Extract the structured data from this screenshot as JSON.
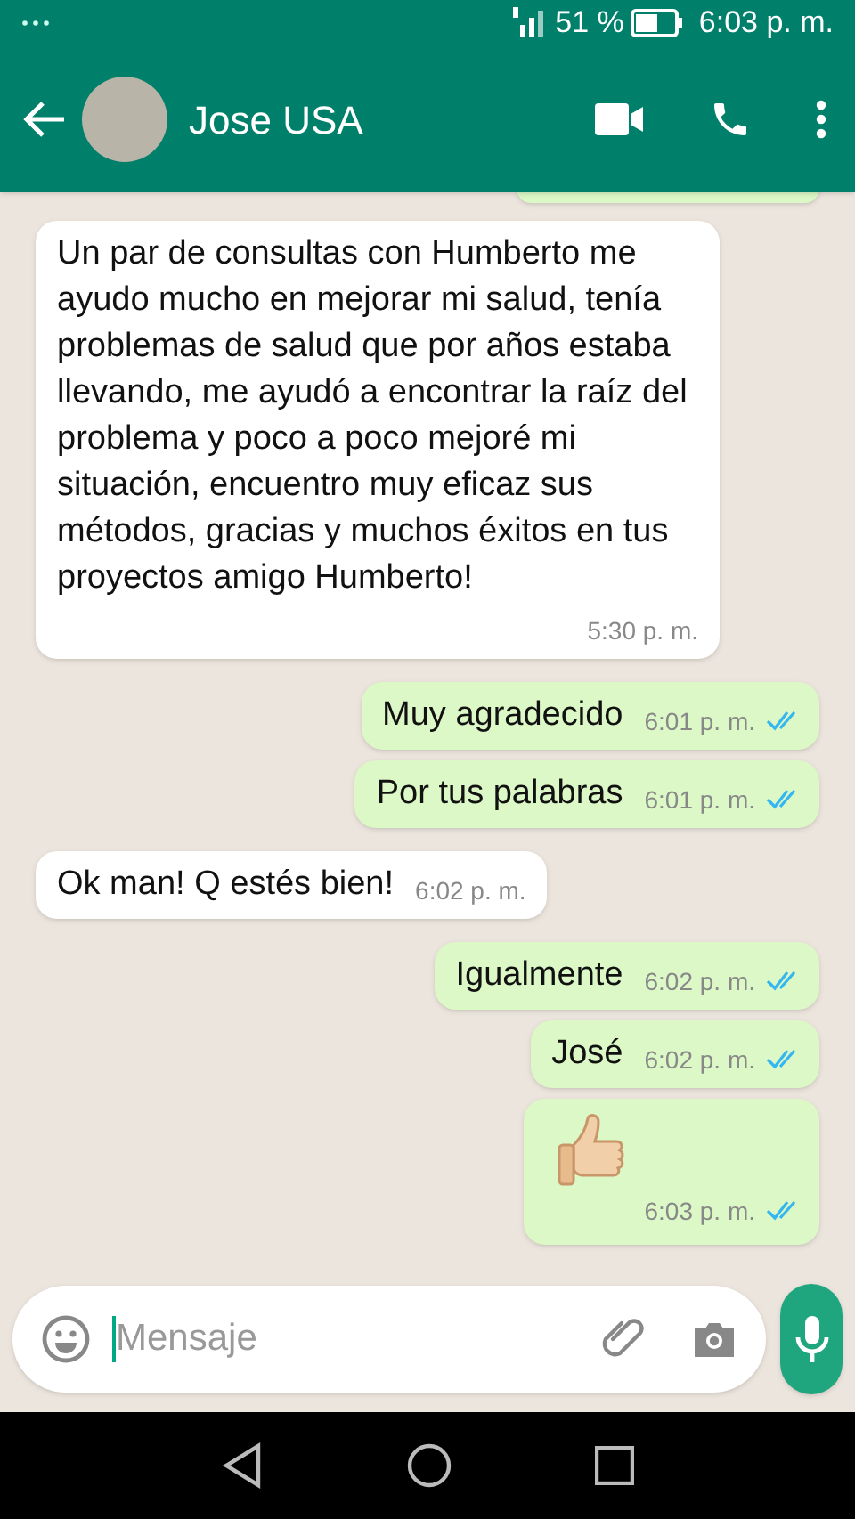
{
  "status_bar": {
    "battery": "51 %",
    "time": "6:03 p. m."
  },
  "header": {
    "contact_name": "Jose USA"
  },
  "messages": [
    {
      "kind": "text",
      "outgoing": false,
      "text": "Un par de consultas con Humberto me ayudo mucho en mejorar mi salud, tenía problemas de salud que por años estaba llevando, me ayudó a encontrar la raíz del problema y poco a poco mejoré mi situación, encuentro muy eficaz sus métodos, gracias y muchos éxitos en tus proyectos amigo Humberto!",
      "time": "5:30 p. m."
    },
    {
      "kind": "text",
      "outgoing": true,
      "text": "Muy agradecido",
      "time": "6:01 p. m.",
      "read": true
    },
    {
      "kind": "text",
      "outgoing": true,
      "text": "Por tus palabras",
      "time": "6:01 p. m.",
      "read": true
    },
    {
      "kind": "text",
      "outgoing": false,
      "text": "Ok man! Q estés bien!",
      "time": "6:02 p. m."
    },
    {
      "kind": "text",
      "outgoing": true,
      "text": "Igualmente",
      "time": "6:02 p. m.",
      "read": true
    },
    {
      "kind": "text",
      "outgoing": true,
      "text": "José",
      "time": "6:02 p. m.",
      "read": true
    },
    {
      "kind": "thumbs_up",
      "outgoing": true,
      "time": "6:03 p. m.",
      "read": true
    }
  ],
  "composer": {
    "placeholder": "Mensaje"
  }
}
